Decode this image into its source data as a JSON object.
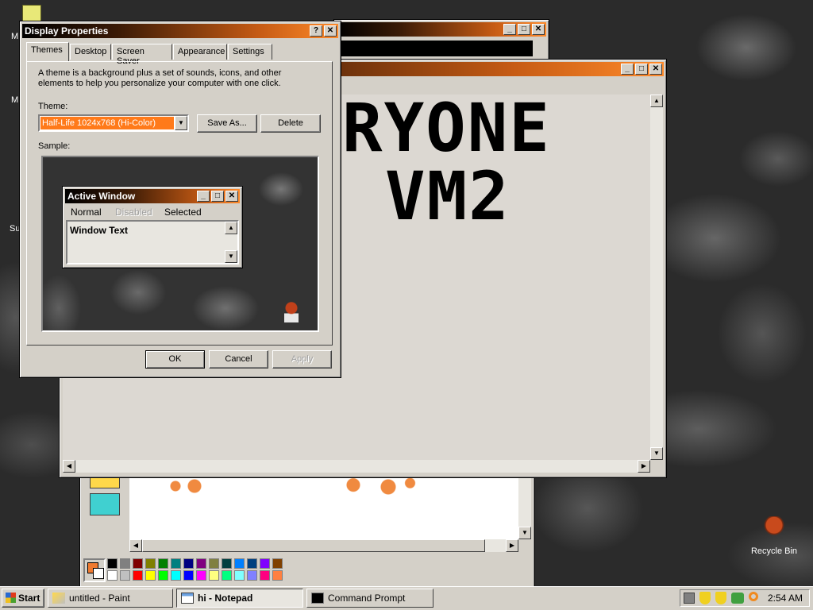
{
  "display_properties": {
    "title": "Display Properties",
    "help_btn": "?",
    "close_btn": "✕",
    "tabs": [
      "Themes",
      "Desktop",
      "Screen Saver",
      "Appearance",
      "Settings"
    ],
    "description": "A theme is a background plus a set of sounds, icons, and other elements to help you personalize your computer with one click.",
    "theme_label": "Theme:",
    "theme_value": "Half-Life 1024x768 (Hi-Color)",
    "save_as": "Save As...",
    "delete": "Delete",
    "sample_label": "Sample:",
    "preview": {
      "window_title": "Active Window",
      "menu": [
        "Normal",
        "Disabled",
        "Selected"
      ],
      "window_text": "Window Text"
    },
    "ok": "OK",
    "cancel": "Cancel",
    "apply": "Apply"
  },
  "notepad": {
    "line1": "RYONE",
    "line2": "VM2"
  },
  "desktop": {
    "recycle_bin": "Recycle Bin"
  },
  "taskbar": {
    "start": "Start",
    "items": [
      "untitled - Paint",
      "hi - Notepad",
      "Command Prompt"
    ],
    "clock": "2:54 AM"
  },
  "colors": {
    "titlebar_accent": "#ff8a2a",
    "window_face": "#d4d0c8",
    "selection": "#ff7a1a"
  },
  "palette": [
    "#000000",
    "#808080",
    "#800000",
    "#808000",
    "#008000",
    "#008080",
    "#000080",
    "#800080",
    "#808040",
    "#004040",
    "#0080ff",
    "#004080",
    "#8000ff",
    "#804000",
    "#ffffff",
    "#c0c0c0",
    "#ff0000",
    "#ffff00",
    "#00ff00",
    "#00ffff",
    "#0000ff",
    "#ff00ff",
    "#ffff80",
    "#00ff80",
    "#80ffff",
    "#8080ff",
    "#ff0080",
    "#ff8040"
  ]
}
